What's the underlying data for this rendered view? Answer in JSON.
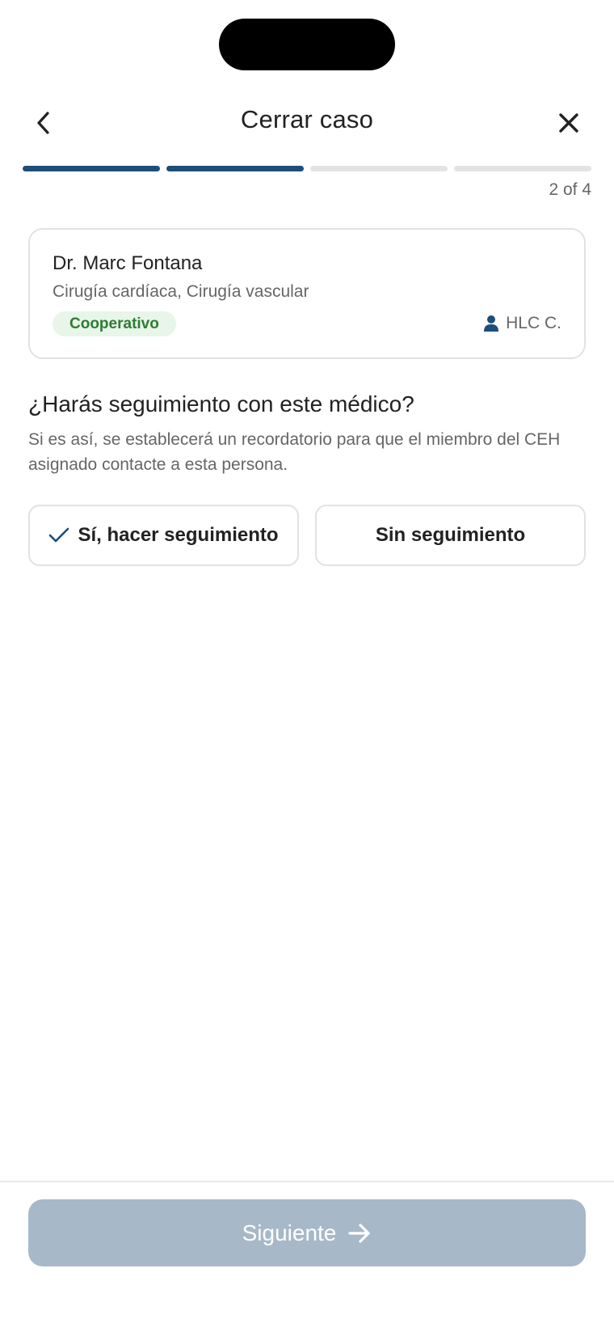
{
  "header": {
    "title": "Cerrar caso",
    "step_count": "2 of 4"
  },
  "progress": {
    "total_steps": 4,
    "current_step": 2
  },
  "doctor": {
    "name": "Dr. Marc Fontana",
    "specialties": "Cirugía cardíaca, Cirugía vascular",
    "status_badge": "Cooperativo",
    "assigned_to": "HLC C."
  },
  "question": {
    "title": "¿Harás seguimiento con este médico?",
    "description": "Si es así, se establecerá un recordatorio para que el miembro del CEH asignado contacte a esta persona."
  },
  "options": {
    "yes_label": "Sí, hacer seguimiento",
    "no_label": "Sin seguimiento",
    "selected": "yes"
  },
  "footer": {
    "next_label": "Siguiente"
  },
  "colors": {
    "accent": "#1e4d7a",
    "badge_bg": "#e8f5e9",
    "badge_text": "#2e7d32",
    "button_disabled": "#a7b8c9"
  },
  "icons": {
    "back": "chevron-left-icon",
    "close": "close-icon",
    "owner": "person-icon",
    "check": "check-icon",
    "next": "arrow-right-icon"
  }
}
